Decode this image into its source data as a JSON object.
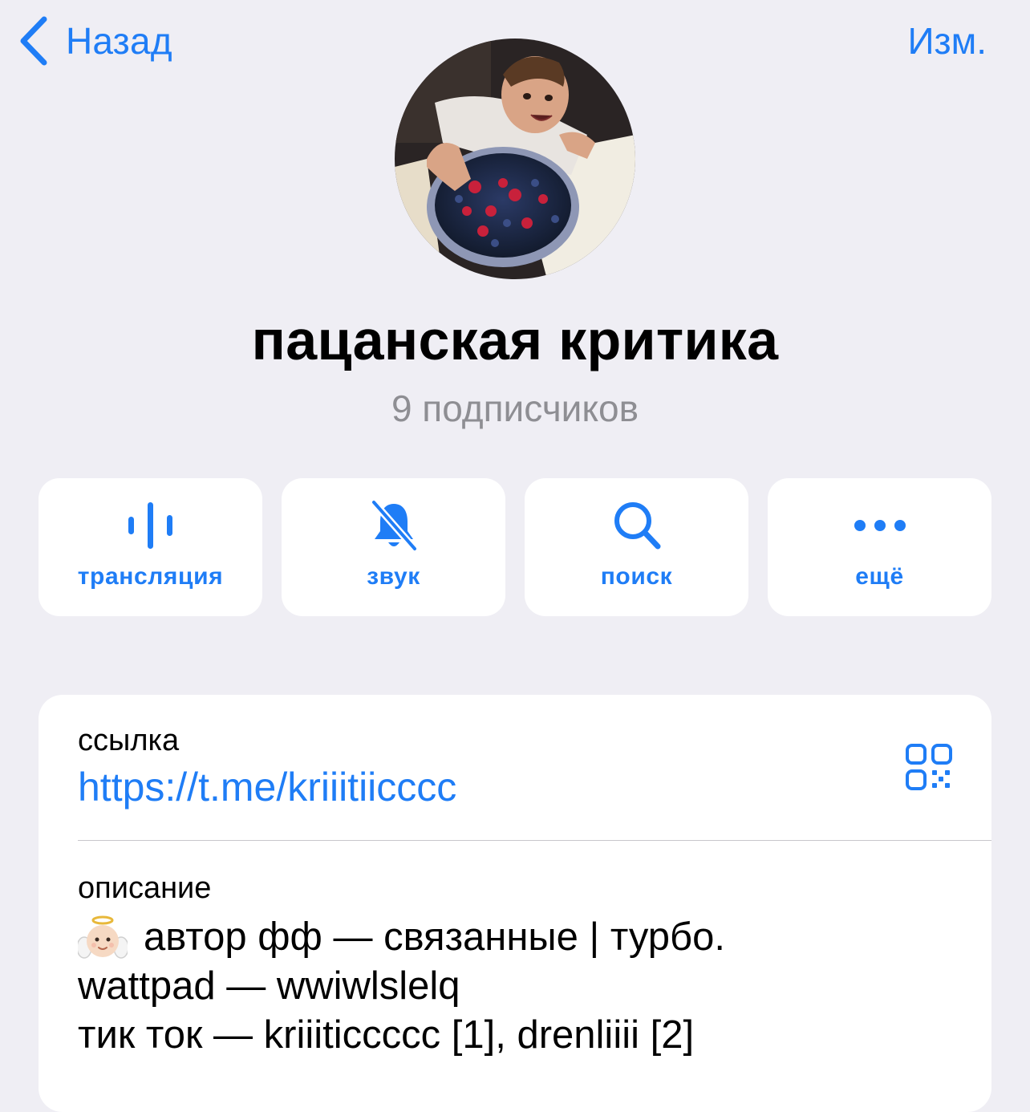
{
  "nav": {
    "back_label": "Назад",
    "edit_label": "Изм.",
    "accent": "#1f7df6"
  },
  "channel": {
    "title": "пацанская критика",
    "subscribers": "9 подписчиков"
  },
  "actions": [
    {
      "icon": "waveform-icon",
      "label": "трансляция"
    },
    {
      "icon": "bell-slash-icon",
      "label": "звук"
    },
    {
      "icon": "search-icon",
      "label": "поиск"
    },
    {
      "icon": "more-icon",
      "label": "ещё"
    }
  ],
  "info": {
    "link_label": "ссылка",
    "link_value": "https://t.me/kriiitiicccc",
    "qr_icon": "qr-code-icon",
    "description_label": "описание",
    "description_emoji": "angel-baby-emoji",
    "description_lines": [
      "автор фф — связанные | турбо.",
      "wattpad — wwiwlslelq",
      "тик ток — kriiiticcccc [1], drenliiii [2]"
    ]
  }
}
